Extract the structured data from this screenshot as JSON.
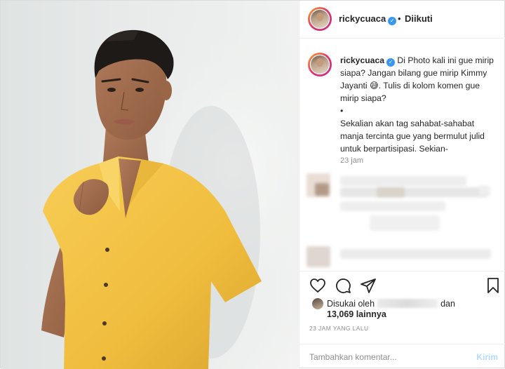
{
  "post": {
    "username": "rickycuaca",
    "follow_status": "Diikuti",
    "separator": "•",
    "verified_mark": "✓",
    "caption": {
      "line1": "Di Photo kali ini gue mirip siapa? Jangan bilang gue mirip Kimmy Jayanti",
      "emoji": "😅",
      "line1b": ". Tulis di kolom komen gue mirip siapa?",
      "bullet": "•",
      "line2": "Sekalian akan tag sahabat-sahabat manja tercinta gue yang bermulut julid untuk berpartisipasi. Sekian-"
    },
    "caption_time": "23 jam",
    "liked_by_prefix": "Disukai oleh",
    "liked_by_suffix": "dan",
    "likes_count": "13,069 lainnya",
    "time_ago": "23 JAM YANG LALU",
    "comment_placeholder": "Tambahkan komentar...",
    "post_button": "Kirim"
  },
  "icons": {
    "like": "heart-icon",
    "comment": "comment-icon",
    "share": "share-icon",
    "save": "bookmark-icon"
  },
  "colors": {
    "verified": "#3897f0",
    "shirt": "#f3c246",
    "post_button_disabled": "#b3dbff"
  }
}
